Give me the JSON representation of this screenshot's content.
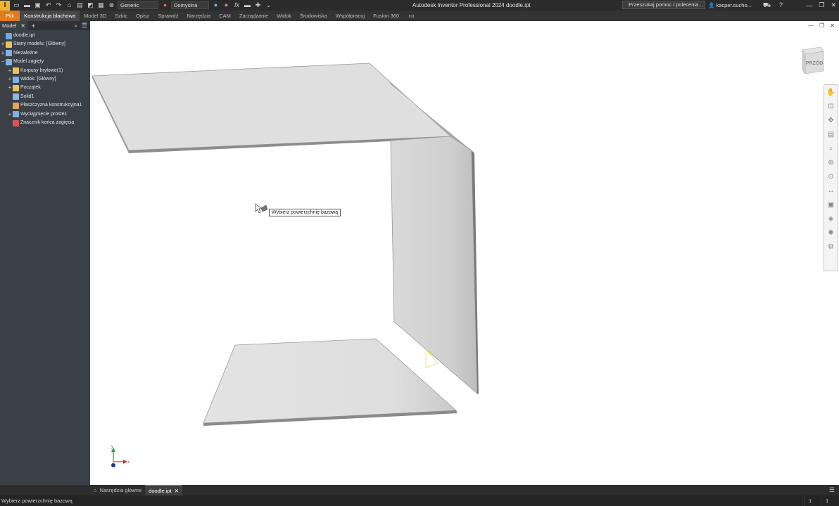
{
  "titlebar": {
    "logo_letter": "I",
    "appearance_dropdown": "Generic",
    "material_dropdown": "Domyślna",
    "fx_symbol": "fx",
    "app_title": "Autodesk Inventor Professional 2024   doodle.ipt",
    "search_placeholder": "Przeszukaj pomoc i polecenia...",
    "user_name": "kacper.sucho..."
  },
  "ribbon": {
    "tabs": [
      {
        "label": "Plik"
      },
      {
        "label": "Konstrukcja blachowa"
      },
      {
        "label": "Model 3D"
      },
      {
        "label": "Szkic"
      },
      {
        "label": "Opisz"
      },
      {
        "label": "Sprawdź"
      },
      {
        "label": "Narzędzia"
      },
      {
        "label": "CAM"
      },
      {
        "label": "Zarządzanie"
      },
      {
        "label": "Widok"
      },
      {
        "label": "Środowiska"
      },
      {
        "label": "Współpracuj"
      },
      {
        "label": "Fusion 360"
      }
    ]
  },
  "browser": {
    "tab_label": "Model",
    "items": [
      {
        "label": "doodle.ipt",
        "icon": "part-file-icon",
        "color": "#6fa8dc",
        "expander": ""
      },
      {
        "label": "Stany modelu: [Główny]",
        "icon": "folder-icon",
        "color": "#e8c35a",
        "expander": "+"
      },
      {
        "label": "Niezależne",
        "icon": "representations-icon",
        "color": "#7fb2e5",
        "expander": "+"
      },
      {
        "label": "Model zagięty",
        "icon": "folded-model-icon",
        "color": "#7fb2e5",
        "expander": "−"
      },
      {
        "label": "Korpusy bryłowe(1)",
        "icon": "folder-icon",
        "color": "#e8c35a",
        "expander": "+"
      },
      {
        "label": "Widok: [Główny]",
        "icon": "view-icon",
        "color": "#7fb2e5",
        "expander": "+"
      },
      {
        "label": "Początek",
        "icon": "folder-icon",
        "color": "#e8c35a",
        "expander": "+"
      },
      {
        "label": "Solid1",
        "icon": "solid-icon",
        "color": "#8fb8de",
        "expander": ""
      },
      {
        "label": "Płaszczyzna konstrukcyjna1",
        "icon": "work-plane-icon",
        "color": "#e0a75e",
        "expander": ""
      },
      {
        "label": "Wyciągnięcie proste1",
        "icon": "extrude-icon",
        "color": "#7fb2e5",
        "expander": "+"
      },
      {
        "label": "Znacznik końca zagięcia",
        "icon": "end-of-part-icon",
        "color": "#d9534f",
        "expander": ""
      }
    ]
  },
  "viewport": {
    "tooltip": "Wybierz powierzchnię bazową",
    "viewcube_label": "PRZÓD",
    "axis_labels": {
      "x": "x",
      "y": "y"
    }
  },
  "doc_tabs": [
    {
      "label": "Narzędzia główne",
      "icon": "home-icon"
    },
    {
      "label": "doodle.ipt",
      "active": true
    }
  ],
  "statusbar": {
    "message": "Wybierz powierzchnię bazową",
    "count_a": "1",
    "count_b": "1"
  }
}
